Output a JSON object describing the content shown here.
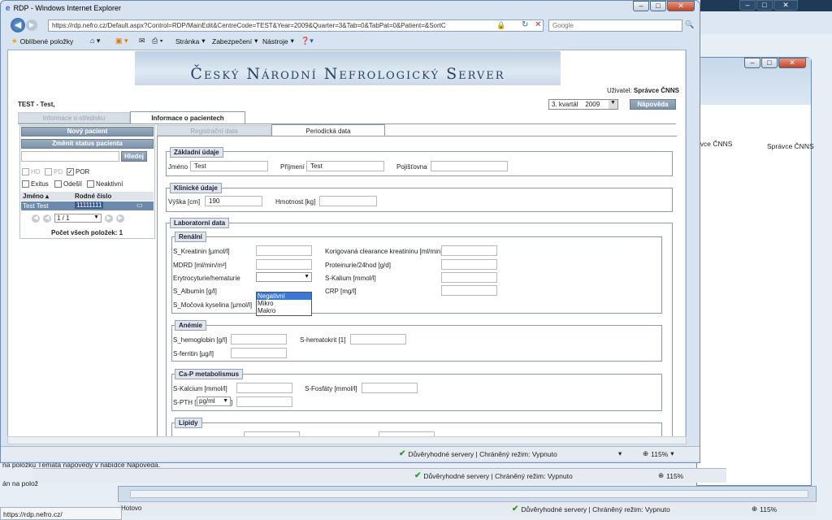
{
  "browser": {
    "title": "RDP - Windows Internet Explorer",
    "url": "https://rdp.nefro.cz/Default.aspx?Control=RDP/MainEdit&CentreCode=TEST&Year=2009&Quarter=3&Tab=0&TabPat=0&Patient=&SortC",
    "search_placeholder": "Google",
    "favorites": "Oblíbené položky",
    "menu": [
      "Stránka",
      "Zabezpečení",
      "Nástroje"
    ],
    "status_text": "Důvěryhodné servery | Chráněný režim: Vypnuto",
    "zoom": "115%"
  },
  "bg_window": {
    "user_text": "Správce ČNNS",
    "user_text_partial": "ávce ČNNS",
    "status_text": "Důvěryhodné servery | Chráněný režim: Vypnuto",
    "zoom": "115%"
  },
  "bottom_window": {
    "status_left": "Hotovo",
    "status_text": "Důvěryhodné servery | Chráněný režim: Vypnuto",
    "zoom": "115%",
    "help_fragment": "na položku Témata nápovědy v nabídce Nápověda.",
    "frag2": "án na polož",
    "url_tooltip": "https://rdp.nefro.cz/"
  },
  "header": {
    "banner": "Český Národní Nefrologický Server",
    "user_label": "Uživatel:",
    "user_name": "Správce ČNNS",
    "quarter_label": "3. kvartál",
    "year": "2009",
    "help_button": "Nápověda",
    "centre_name": "TEST - Test,"
  },
  "main_tabs": [
    "Informace o středisku",
    "Informace o pacientech"
  ],
  "left": {
    "new_patient": "Nový pacient",
    "change_status": "Změnit status pacienta",
    "search_button": "Hledej",
    "filters": [
      "HD",
      "PD",
      "POR",
      "Exitus",
      "Odešlí",
      "Neaktivní"
    ],
    "col_name": "Jméno",
    "col_birth": "Rodné číslo",
    "row_name": "Test Test",
    "row_birth": "11111111",
    "pager": "1 / 1",
    "total": "Počet všech položek: 1"
  },
  "sub_tabs": [
    "Registrační data",
    "Periodická data"
  ],
  "basic": {
    "legend": "Základní údaje",
    "name_label": "Jméno",
    "name_value": "Test",
    "surname_label": "Příjmení",
    "surname_value": "Test",
    "insurance_label": "Pojišťovna"
  },
  "clinical": {
    "legend": "Klinické údaje",
    "height_label": "Výška [cm]",
    "height_value": "190",
    "weight_label": "Hmotnost [kg]"
  },
  "lab": {
    "legend": "Laboratorní data",
    "renal_legend": "Renální",
    "kreatinin": "S_Kreatinin [µmol/l]",
    "mdrd": "MDRD [ml/min/m²]",
    "erytro": "Erytrocyturie/hematurie",
    "albumin": "S_Albumin [g/l]",
    "mocova": "S_Močová kyselina [µmol/l]",
    "clearance": "Korigovaná clearance kreatininu [ml/min]",
    "proteinurie": "Proteinurie/24hod [g/d]",
    "kalium": "S-Kalium [mmol/l]",
    "crp": "CRP [mg/l]",
    "dropdown_options": [
      "Negativní",
      "Mikro",
      "Makro"
    ],
    "anemie_legend": "Anémie",
    "hemoglobin": "S_hemoglobin [g/l]",
    "hematokrit": "S-hematokrit [1]",
    "ferritin": "S-ferritin [µg/l]",
    "cap_legend": "Ca-P metabolismus",
    "kalcium": "S-Kalcium [mmol/l]",
    "fosfaty": "S-Fosfáty [mmol/l]",
    "pth": "S-PTH [",
    "pth_unit": "pg/ml",
    "pth_close": "]",
    "lipidy_legend": "Lipidy"
  }
}
